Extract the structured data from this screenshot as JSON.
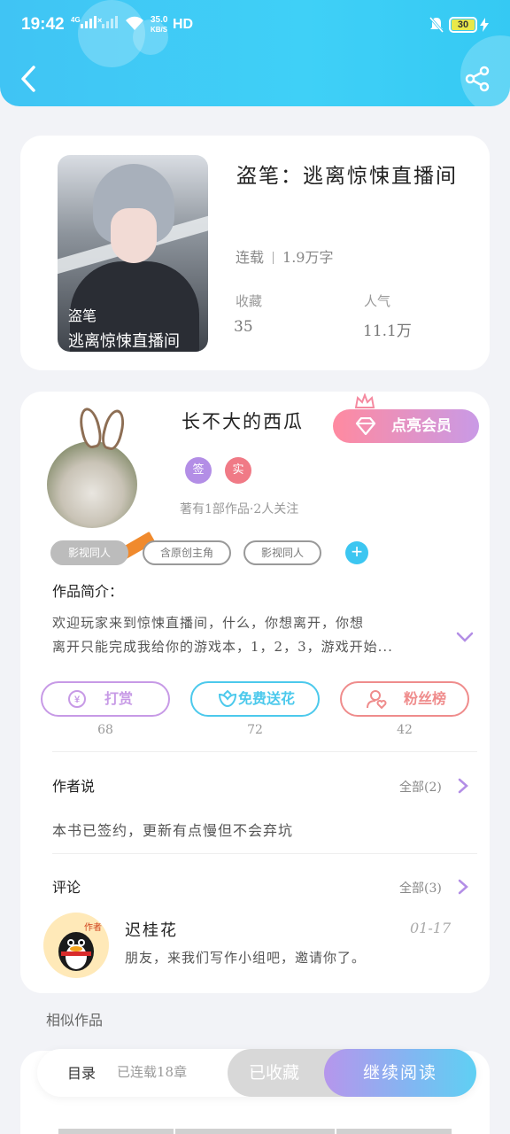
{
  "status_bar": {
    "time": "19:42",
    "sig1": "4G",
    "sig2": "×",
    "speed_value": "35.0",
    "speed_unit": "KB/S",
    "hd": "HD",
    "battery": "30"
  },
  "header": {
    "back_icon": "chevron-left-icon",
    "share_icon": "share-icon"
  },
  "book": {
    "cover_line1": "盗笔",
    "cover_line2": "逃离惊悚直播间",
    "title": "盗笔：逃离惊悚直播间",
    "status": "连载",
    "word_count": "1.9万字",
    "favorites_label": "收藏",
    "favorites_value": "35",
    "popularity_label": "人气",
    "popularity_value": "11.1万"
  },
  "author": {
    "name": "长不大的西瓜",
    "vip_label": "点亮会员",
    "badge1": "签",
    "badge2": "实",
    "works_info": "著有1部作品·2人关注",
    "tags": [
      "影视同人",
      "含原创主角",
      "影视同人"
    ]
  },
  "intro": {
    "label": "作品简介：",
    "line1": "欢迎玩家来到惊悚直播间，什么，你想离开，你想",
    "line2": "离开只能完成我给你的游戏本，1，2，3，游戏开始..."
  },
  "actions": {
    "reward_label": "打赏",
    "reward_count": "68",
    "flower_label": "免费送花",
    "flower_count": "72",
    "fans_label": "粉丝榜",
    "fans_count": "42"
  },
  "author_says": {
    "label": "作者说",
    "all": "全部(2)",
    "text": "本书已签约，更新有点慢但不会弃坑"
  },
  "comments": {
    "label": "评论",
    "all": "全部(3)",
    "avatar_tag": "作者",
    "items": [
      {
        "name": "迟桂花",
        "date": "01-17",
        "text": "朋友，来我们写作小组吧，邀请你了。"
      }
    ]
  },
  "similar": {
    "label": "相似作品"
  },
  "bottom_bar": {
    "toc_label": "目录",
    "chapters": "已连载18章",
    "collected_label": "已收藏",
    "continue_label": "继续阅读"
  },
  "colors": {
    "header": "#40c4f4",
    "reward": "#c79ae6",
    "flower": "#4cc9ec",
    "fans": "#ef8c8c",
    "vip_start": "#ff8aa0",
    "vip_end": "#c99ae6"
  }
}
